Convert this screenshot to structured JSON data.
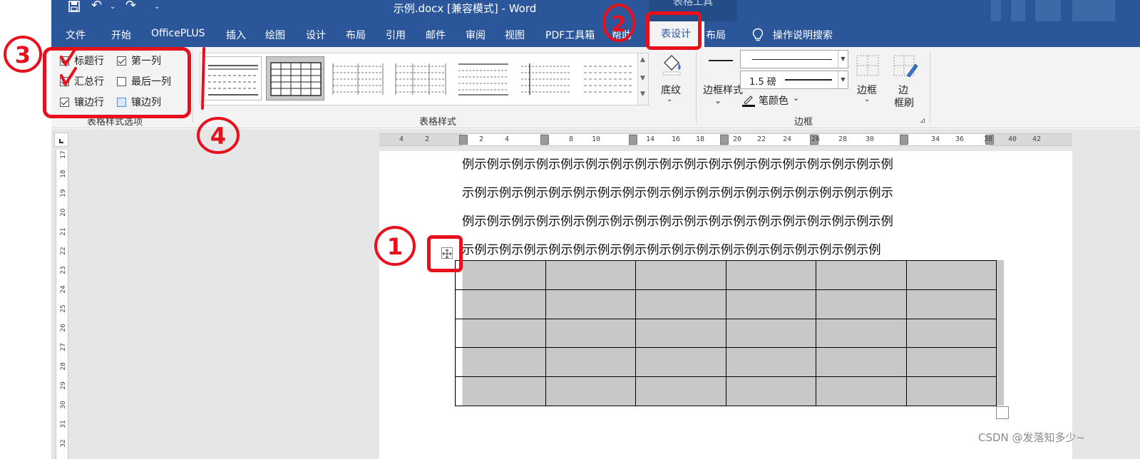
{
  "window": {
    "title": "示例.docx [兼容模式]  -  Word",
    "context_tab_title": "表格工具"
  },
  "menu": {
    "tabs": [
      "文件",
      "开始",
      "OfficePLUS",
      "插入",
      "绘图",
      "设计",
      "布局",
      "引用",
      "邮件",
      "审阅",
      "视图",
      "PDF工具箱",
      "帮助",
      "表设计",
      "布局"
    ],
    "active_tab": "表设计",
    "tell_me": "操作说明搜索"
  },
  "ribbon": {
    "style_options": {
      "header_row": "标题行",
      "first_column": "第一列",
      "total_row": "汇总行",
      "last_column": "最后一列",
      "banded_rows": "镶边行",
      "banded_columns": "镶边列",
      "group_label": "表格样式选项",
      "states": {
        "header_row": true,
        "first_column": true,
        "total_row": true,
        "last_column": false,
        "banded_rows": true,
        "banded_columns": false
      }
    },
    "table_styles": {
      "group_label": "表格样式",
      "shading_label": "底纹"
    },
    "borders": {
      "group_label": "边框",
      "border_styles_label": "边框样式",
      "line_weight": "1.5 磅",
      "pen_color_label": "笔颜色",
      "borders_label": "边框",
      "border_painter_label": "边框刷"
    }
  },
  "ruler": {
    "horizontal": [
      "4",
      "2",
      "2",
      "4",
      "8",
      "10",
      "14",
      "16",
      "18",
      "20",
      "22",
      "24",
      "26",
      "28",
      "30",
      "34",
      "36",
      "38",
      "40",
      "42"
    ],
    "vertical": [
      "17",
      "18",
      "19",
      "20",
      "21",
      "22",
      "23",
      "24",
      "25",
      "26",
      "27",
      "28",
      "29",
      "30",
      "31",
      "32"
    ]
  },
  "document": {
    "paragraphs": [
      "例示例示例示例示例示例示例示例示例示例示例示例示例示例示例示例示例示例",
      "示例示例示例示例示例示例示例示例示例示例示例示例示例示例示例示例示例示",
      "例示例示例示例示例示例示例示例示例示例示例示例示例示例示例示例示例示例",
      "示例示例示例示例示例示例示例示例示例示例示例示例示例示例示例示例示例"
    ],
    "table": {
      "rows": 5,
      "columns": 6
    }
  },
  "annotations": [
    "1",
    "2",
    "3",
    "4"
  ],
  "watermark": "CSDN @发落知多少~",
  "colors": {
    "word_blue": "#2b579a",
    "annotation_red": "#e8101c",
    "table_fill": "#c8c8c8"
  }
}
